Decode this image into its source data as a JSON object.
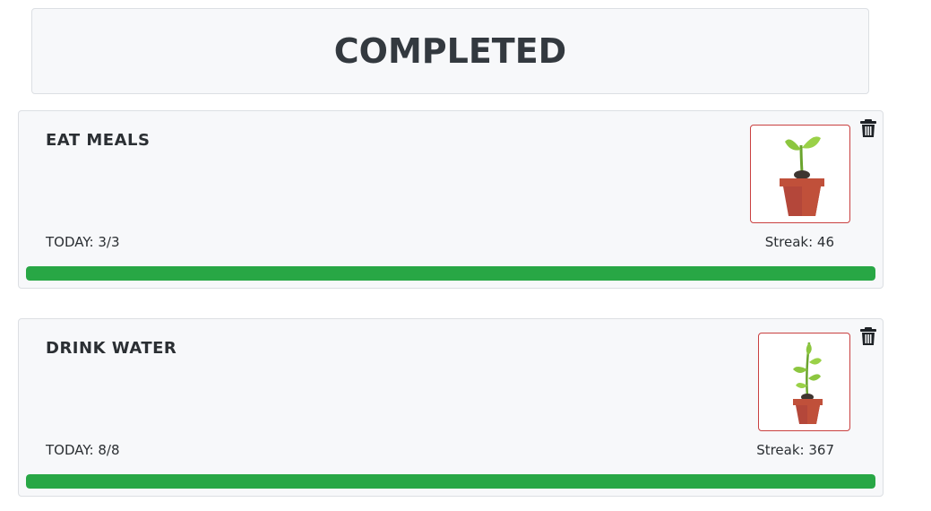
{
  "header": {
    "title": "COMPLETED"
  },
  "colors": {
    "progress": "#28a745",
    "frame_border": "#c94040",
    "pot": "#c0503a",
    "leaf": "#8cc63f"
  },
  "habits": [
    {
      "title": "EAT MEALS",
      "today": "TODAY: 3/3",
      "streak": "Streak: 46",
      "progress_fraction": 1.0,
      "plant_icon": "sprout-pot-icon"
    },
    {
      "title": "DRINK WATER",
      "today": "TODAY: 8/8",
      "streak": "Streak: 367",
      "progress_fraction": 1.0,
      "plant_icon": "young-plant-pot-icon"
    }
  ]
}
